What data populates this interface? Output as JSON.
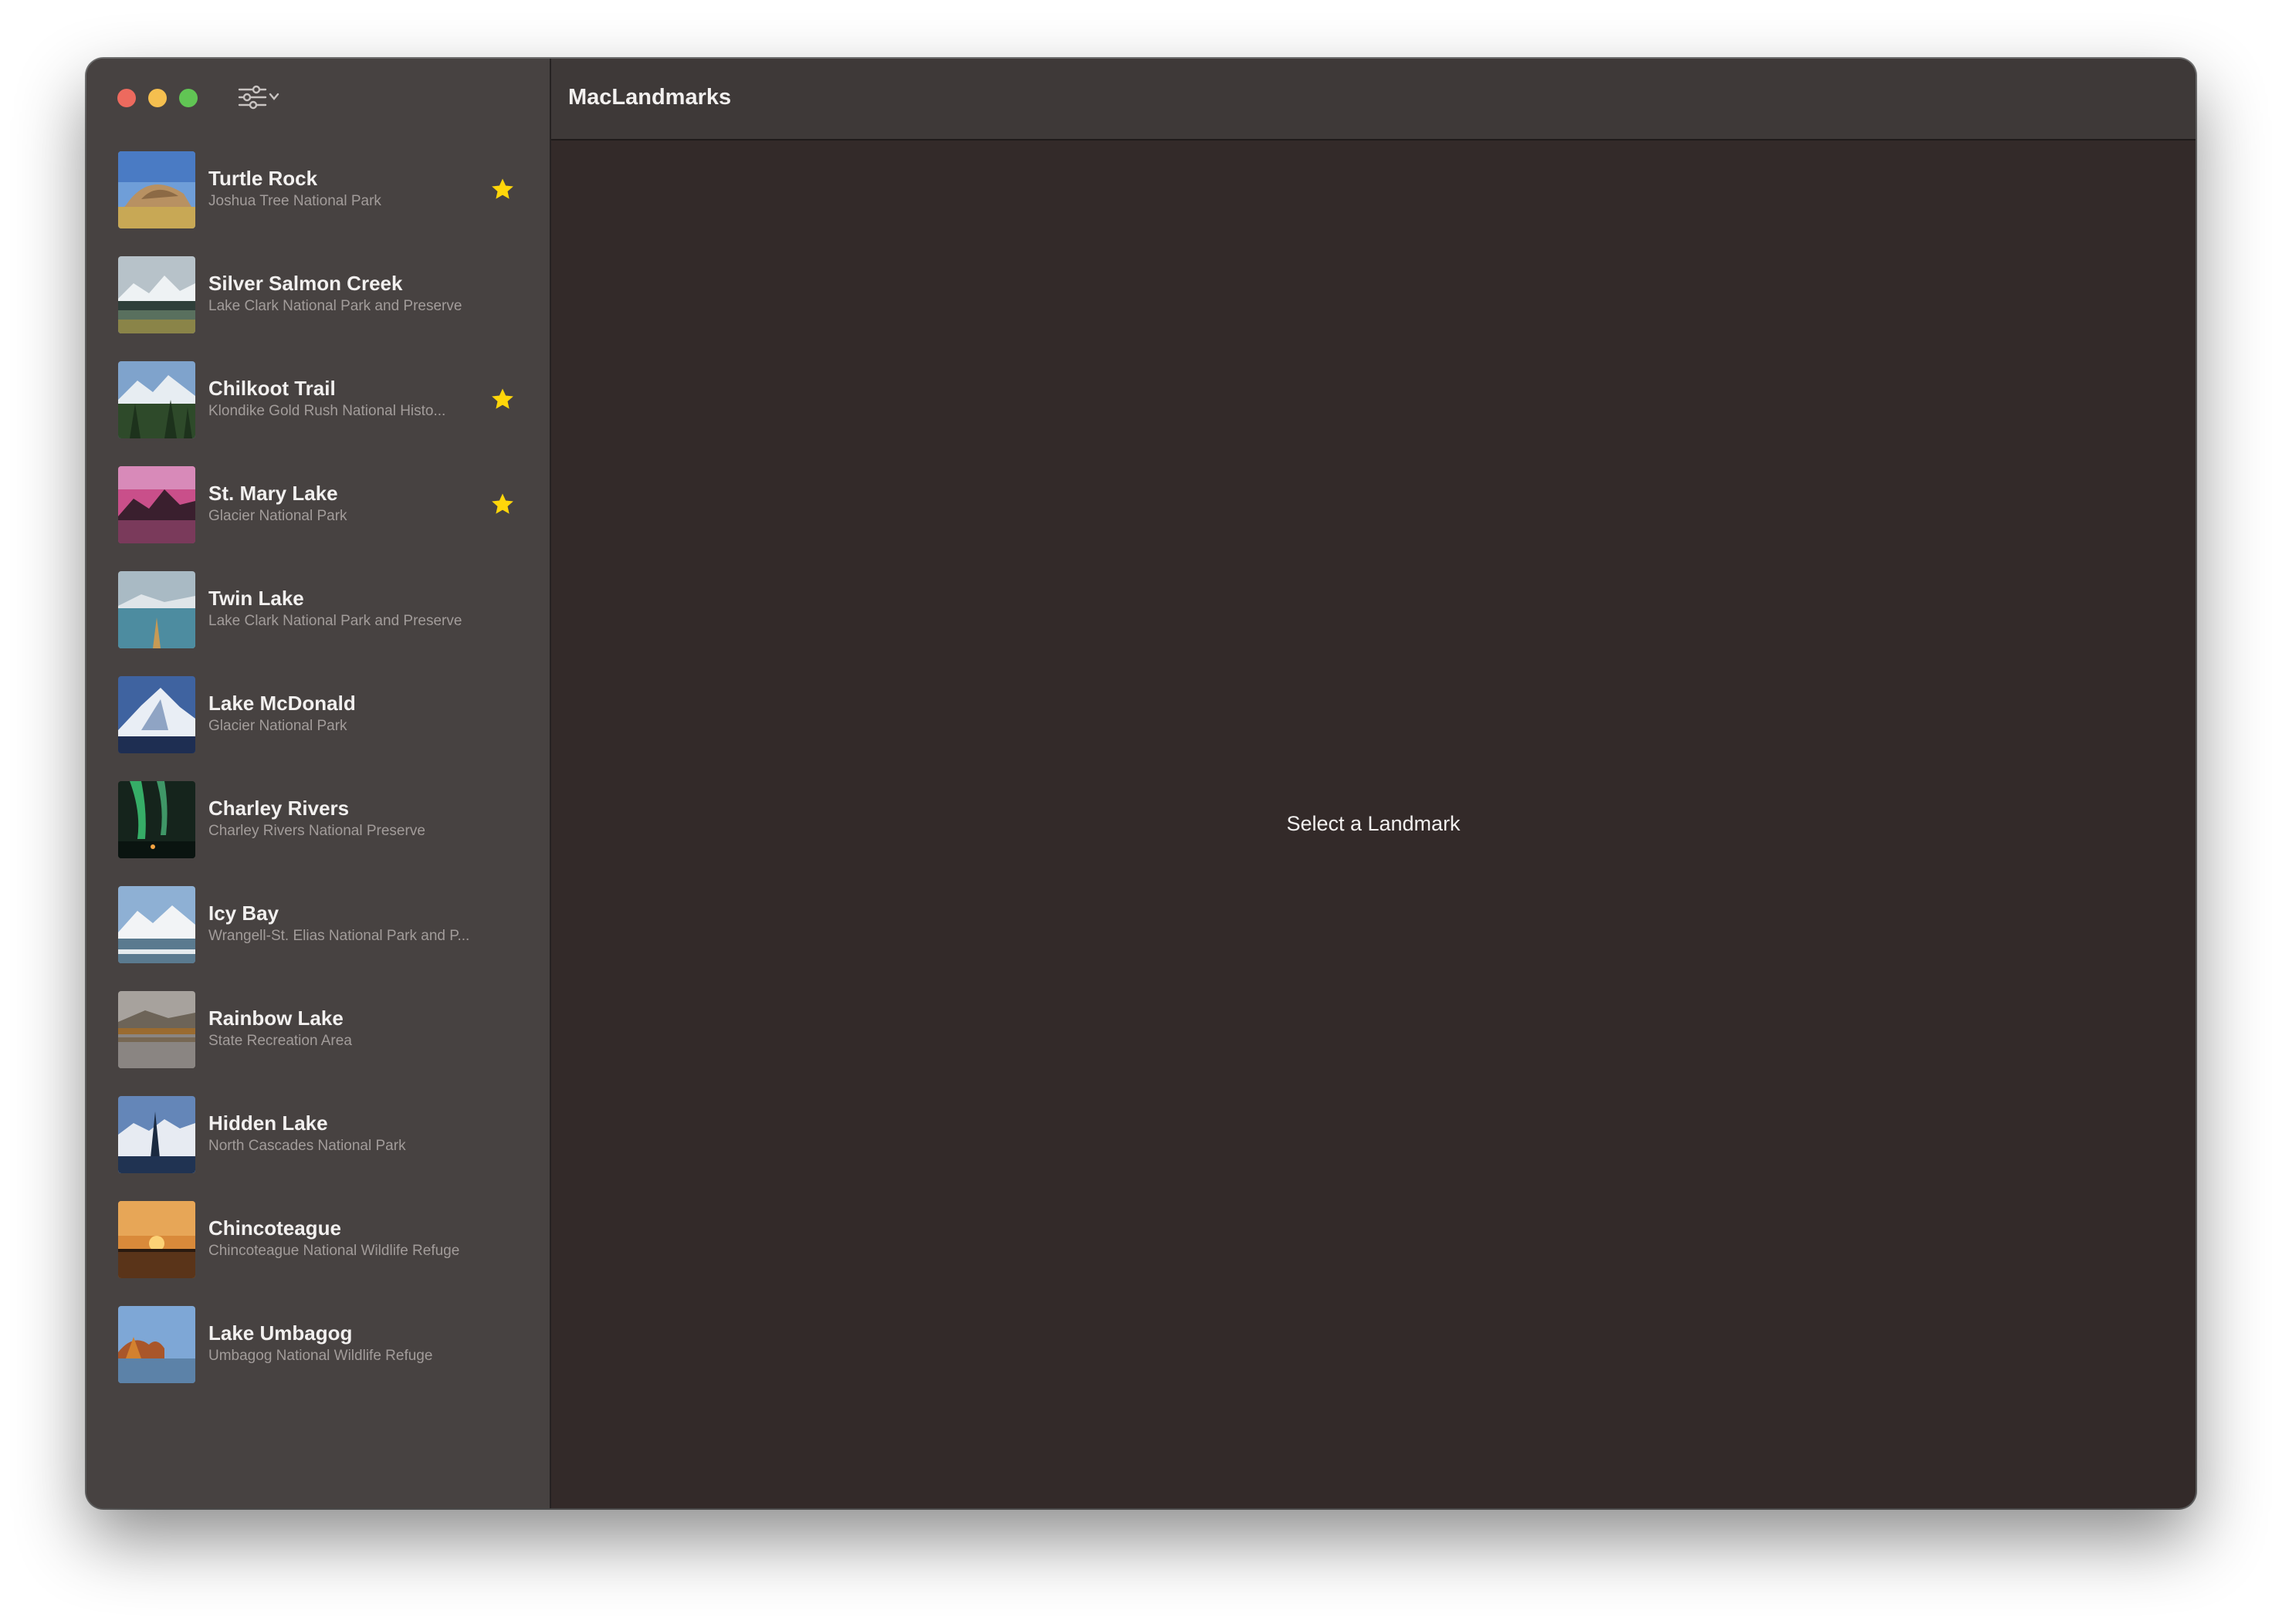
{
  "window": {
    "app_title": "MacLandmarks",
    "placeholder": "Select a Landmark"
  },
  "colors": {
    "sidebar_bg": "#474241",
    "content_bg": "#332a29",
    "header_bg": "#3e3938",
    "favorite_star": "#ffd60a",
    "close": "#ed6a5e",
    "minimize": "#f5bf4f",
    "zoom": "#61c554"
  },
  "toolbar": {
    "filter_icon": "slider-horizontal-3-icon"
  },
  "landmarks": [
    {
      "name": "Turtle Rock",
      "park": "Joshua Tree National Park",
      "favorite": true
    },
    {
      "name": "Silver Salmon Creek",
      "park": "Lake Clark National Park and Preserve",
      "favorite": false
    },
    {
      "name": "Chilkoot Trail",
      "park": "Klondike Gold Rush National Histo...",
      "favorite": true
    },
    {
      "name": "St. Mary Lake",
      "park": "Glacier National Park",
      "favorite": true
    },
    {
      "name": "Twin Lake",
      "park": "Lake Clark National Park and Preserve",
      "favorite": false
    },
    {
      "name": "Lake McDonald",
      "park": "Glacier National Park",
      "favorite": false
    },
    {
      "name": "Charley Rivers",
      "park": "Charley Rivers National Preserve",
      "favorite": false
    },
    {
      "name": "Icy Bay",
      "park": "Wrangell-St. Elias National Park and P...",
      "favorite": false
    },
    {
      "name": "Rainbow Lake",
      "park": "State Recreation Area",
      "favorite": false
    },
    {
      "name": "Hidden Lake",
      "park": "North Cascades National Park",
      "favorite": false
    },
    {
      "name": "Chincoteague",
      "park": "Chincoteague National Wildlife Refuge",
      "favorite": false
    },
    {
      "name": "Lake Umbagog",
      "park": "Umbagog National Wildlife Refuge",
      "favorite": false
    }
  ]
}
